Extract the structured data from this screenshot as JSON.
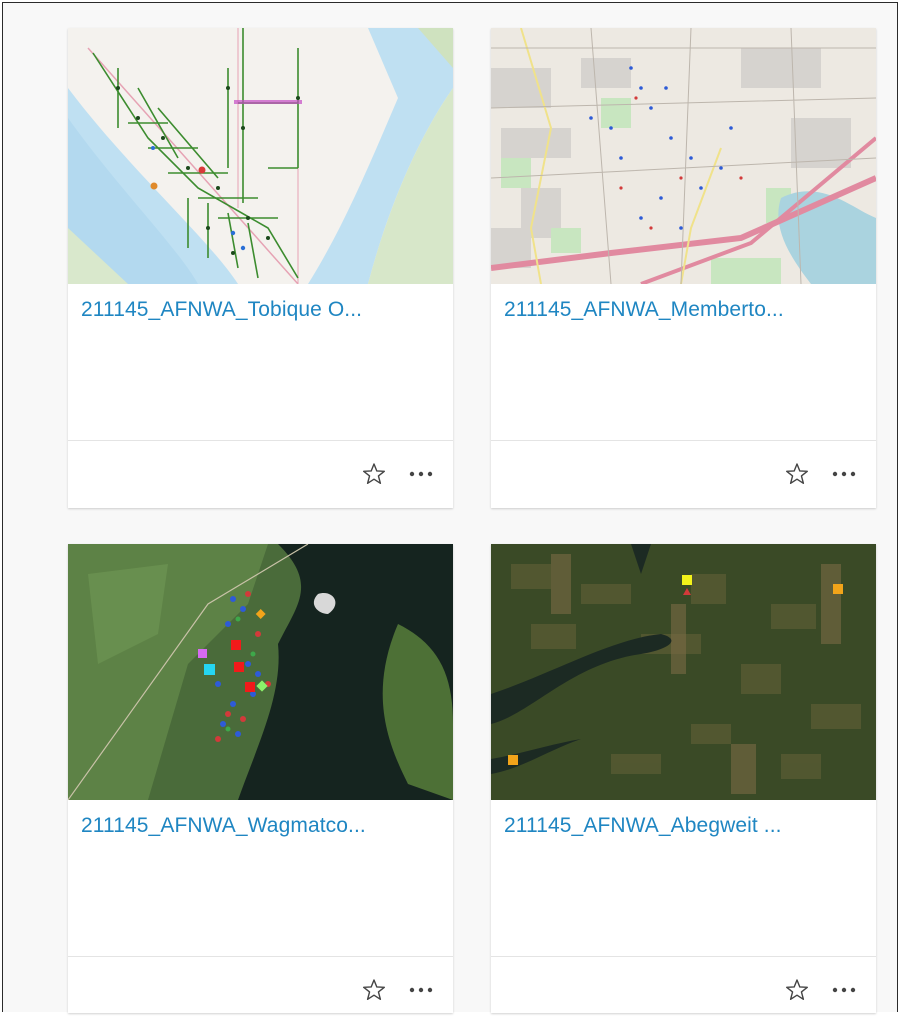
{
  "cards": [
    {
      "title": "211145_AFNWA_Tobique O...",
      "thumbnail_icon": "topographic-map-icon",
      "favorite_icon": "star-icon",
      "more_icon": "ellipsis-icon"
    },
    {
      "title": "211145_AFNWA_Memberto...",
      "thumbnail_icon": "street-map-icon",
      "favorite_icon": "star-icon",
      "more_icon": "ellipsis-icon"
    },
    {
      "title": "211145_AFNWA_Wagmatco...",
      "thumbnail_icon": "satellite-map-icon",
      "favorite_icon": "star-icon",
      "more_icon": "ellipsis-icon"
    },
    {
      "title": "211145_AFNWA_Abegweit ...",
      "thumbnail_icon": "satellite-map-icon",
      "favorite_icon": "star-icon",
      "more_icon": "ellipsis-icon"
    }
  ],
  "colors": {
    "title": "#1f86c2",
    "icon": "#444444",
    "frame_border": "#2b2b2b"
  }
}
